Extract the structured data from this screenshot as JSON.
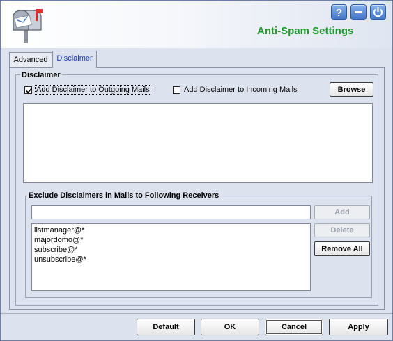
{
  "header": {
    "title": "Anti-Spam Settings",
    "icons": {
      "app": "mailbox-icon",
      "help": "help-icon",
      "minimize": "minimize-icon",
      "close": "power-icon"
    }
  },
  "tabs": [
    {
      "label": "Advanced",
      "active": false
    },
    {
      "label": "Disclaimer",
      "active": true
    }
  ],
  "disclaimer": {
    "section_title": "Disclaimer",
    "outgoing_checkbox": {
      "label": "Add Disclaimer to Outgoing Mails",
      "checked": true
    },
    "incoming_checkbox": {
      "label": "Add Disclaimer to Incoming Mails",
      "checked": false
    },
    "browse_label": "Browse",
    "disclaimer_text": ""
  },
  "exclude": {
    "title": "Exclude Disclaimers in Mails to Following Receivers",
    "input_value": "",
    "add_label": "Add",
    "delete_label": "Delete",
    "remove_all_label": "Remove All",
    "items": [
      "listmanager@*",
      "majordomo@*",
      "subscribe@*",
      "unsubscribe@*"
    ]
  },
  "footer": {
    "default_label": "Default",
    "ok_label": "OK",
    "cancel_label": "Cancel",
    "apply_label": "Apply"
  },
  "colors": {
    "title_green": "#1d9a2a",
    "tab_active_text": "#1a3fa3",
    "window_bg": "#dde2ef"
  }
}
